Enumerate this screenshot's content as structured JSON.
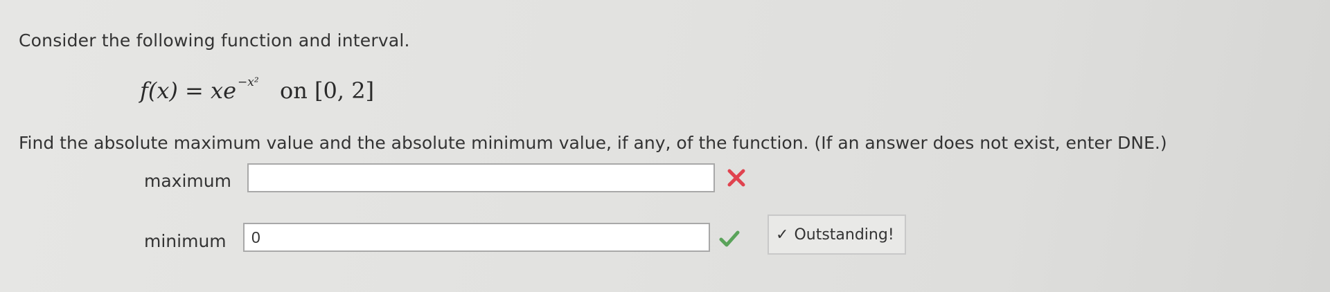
{
  "problem": {
    "intro": "Consider the following function and interval.",
    "formula": {
      "lhs": "f(x)",
      "equals": "=",
      "base": "xe",
      "exponent": "−x²",
      "conjunction": "on",
      "interval": "[0, 2]"
    },
    "question": "Find the absolute maximum value and the absolute minimum value, if any, of the function. (If an answer does not exist, enter DNE.)"
  },
  "answers": {
    "maximum": {
      "label": "maximum",
      "value": "",
      "status": "incorrect",
      "icon": "x-mark-icon",
      "color": "#e0434f"
    },
    "minimum": {
      "label": "minimum",
      "value": "0",
      "status": "correct",
      "icon": "check-mark-icon",
      "color": "#5aa35a"
    }
  },
  "feedback": {
    "icon": "check-icon",
    "text": "Outstanding!"
  }
}
